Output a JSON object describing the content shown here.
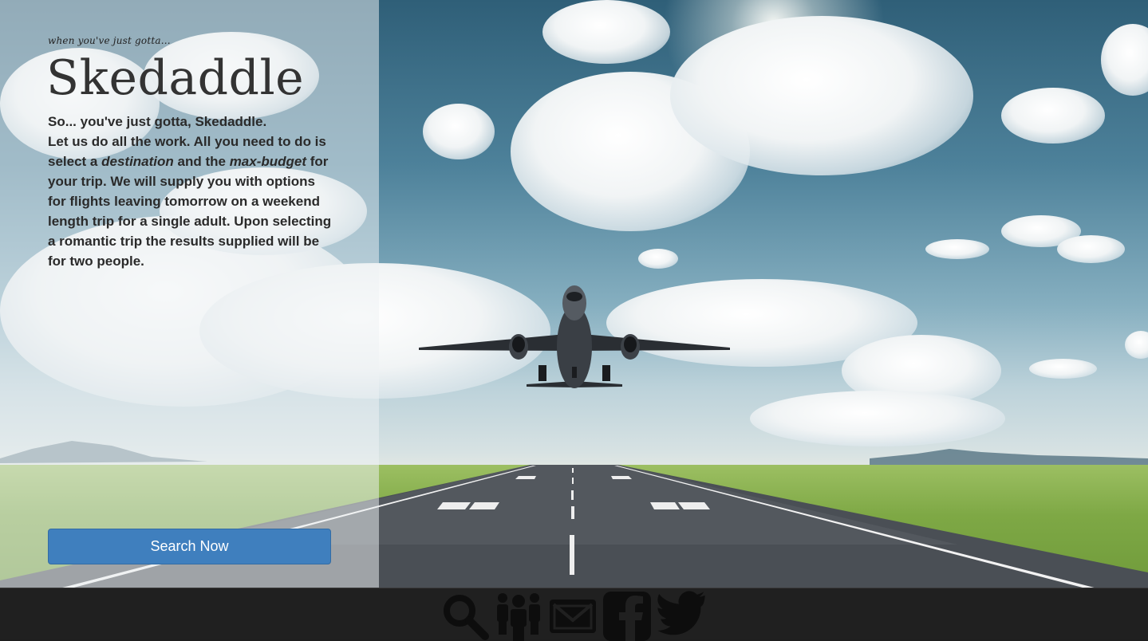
{
  "header": {
    "tagline": "when you've just gotta...",
    "brand": "Skedaddle"
  },
  "intro": {
    "line1": "So... you've just gotta, Skedaddle.",
    "part1": "Let us do all the work. All you need to do is select a ",
    "destination": "destination",
    "part2": " and the ",
    "max_budget": "max-budget",
    "part3": " for your trip. We will supply you with options for flights leaving tomorrow on a weekend length trip for a single adult. Upon selecting a romantic trip the results supplied will be for two people."
  },
  "actions": {
    "search_label": "Search Now",
    "accent_color": "#3f7fbe"
  },
  "footer": {
    "icons": [
      "search-icon",
      "people-icon",
      "mail-icon",
      "facebook-icon",
      "twitter-icon"
    ],
    "icon_color": "#0d0d0d",
    "background": "#202020"
  }
}
